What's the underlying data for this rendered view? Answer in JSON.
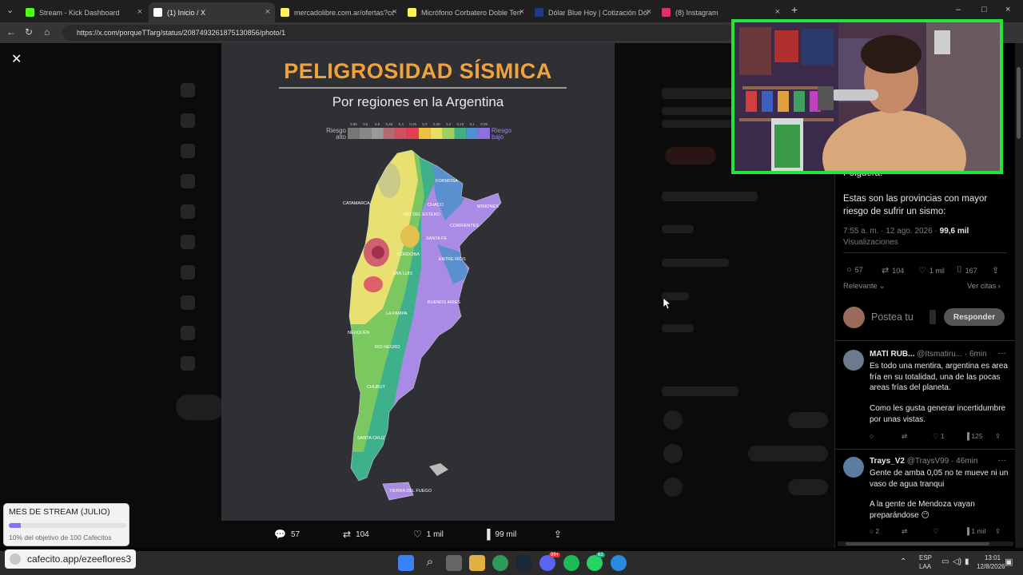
{
  "browser": {
    "tabs": [
      {
        "label": "Stream - Kick Dashboard",
        "color": "#53fc18"
      },
      {
        "label": "(1) Inicio / X",
        "color": "#ffffff"
      },
      {
        "label": "mercadolibre.com.ar/ofertas?cont",
        "color": "#fff159"
      },
      {
        "label": "Micrófono Corbatero Doble Terral",
        "color": "#fff159"
      },
      {
        "label": "Dólar Blue Hoy | Cotización Dólar",
        "color": "#1e3a8a"
      },
      {
        "label": "(8) Instagram",
        "color": "#e1306c"
      }
    ],
    "url": "https://x.com/porqueTTarg/status/2087493261875130856/photo/1",
    "new_tab": "+"
  },
  "photo": {
    "title": "PELIGROSIDAD SÍSMICA",
    "subtitle": "Por regiones en la Argentina",
    "legend_high": "Riesgo alto",
    "legend_low": "Riesgo bajo",
    "legend_values": [
      "0,95",
      "0,6",
      "0,5",
      "0,45",
      "0,4",
      "0,35",
      "0,3",
      "0,25",
      "0,2",
      "0,15",
      "0,1",
      "0,05"
    ],
    "legend_colors": [
      "#777777",
      "#888888",
      "#9a9a9a",
      "#b06a70",
      "#d05060",
      "#e04050",
      "#f0c040",
      "#e8e060",
      "#a0d060",
      "#40b080",
      "#5090d0",
      "#9070e0"
    ],
    "provinces": [
      "FORMOSA",
      "CHACO",
      "MISIONES",
      "CATAMARCA",
      "RÍO DEL ESTERO",
      "SANTA FE",
      "CORRIENTES",
      "ENTRE RÍOS",
      "CÓRDOBA",
      "SAN LUIS",
      "BUENOS AIRES",
      "LA PAMPA",
      "NEUQUÉN",
      "RÍO NEGRO",
      "CHUBUT",
      "SANTA CRUZ",
      "TIERRA DEL FUEGO"
    ]
  },
  "photo_actions": {
    "replies": "57",
    "retweets": "104",
    "likes": "1 mil",
    "views": "99 mil"
  },
  "tweet": {
    "text_top": "Polguera.",
    "text": "Estas son las provincias con mayor riesgo de sufrir un sismo:",
    "time": "7:55 a. m. · 12 ago. 2026 ·",
    "views_count": "99,6 mil",
    "views_label": "Visualizaciones",
    "replies": "57",
    "retweets": "104",
    "likes": "1 mil",
    "bookmarks": "167",
    "sort": "Relevante",
    "quotes": "Ver citas",
    "reply_placeholder": "Postea tu",
    "reply_button": "Responder"
  },
  "replies": [
    {
      "name": "MATI RUB...",
      "handle": "@Itsmatiru...",
      "time": "· 6min",
      "text1": "Es todo una mentira, argentina es area fría en su totalidad, una de las pocas areas frías del planeta.",
      "text2": "Como les gusta generar incertidumbre por unas vistas.",
      "likes": "1",
      "views": "125"
    },
    {
      "name": "Trays_V2",
      "handle": "@TraysV99",
      "time": "· 46min",
      "text1": "Gente de amba 0,05 no te mueve ni un vaso de agua tranqui",
      "text2": "A la gente de Mendoza vayan preparándose 😶",
      "replies": "2",
      "views": "1 mil"
    }
  ],
  "stream_goal": {
    "title": "MES DE STREAM (JULIO)",
    "progress": 0.1,
    "subtitle": "10% del objetivo de 100 Cafecitos"
  },
  "cafecito": {
    "label": "cafecito.app/ezeeflores3"
  },
  "taskbar": {
    "lang": "ESP",
    "lang2": "LAA",
    "time": "13:01",
    "date": "12/8/2026",
    "badge1": "99+",
    "badge2": "63"
  },
  "colors": {
    "webcam_border": "#22e53a",
    "accent_orange": "#f2a23a",
    "goal_fill": "#8c6ff0"
  }
}
